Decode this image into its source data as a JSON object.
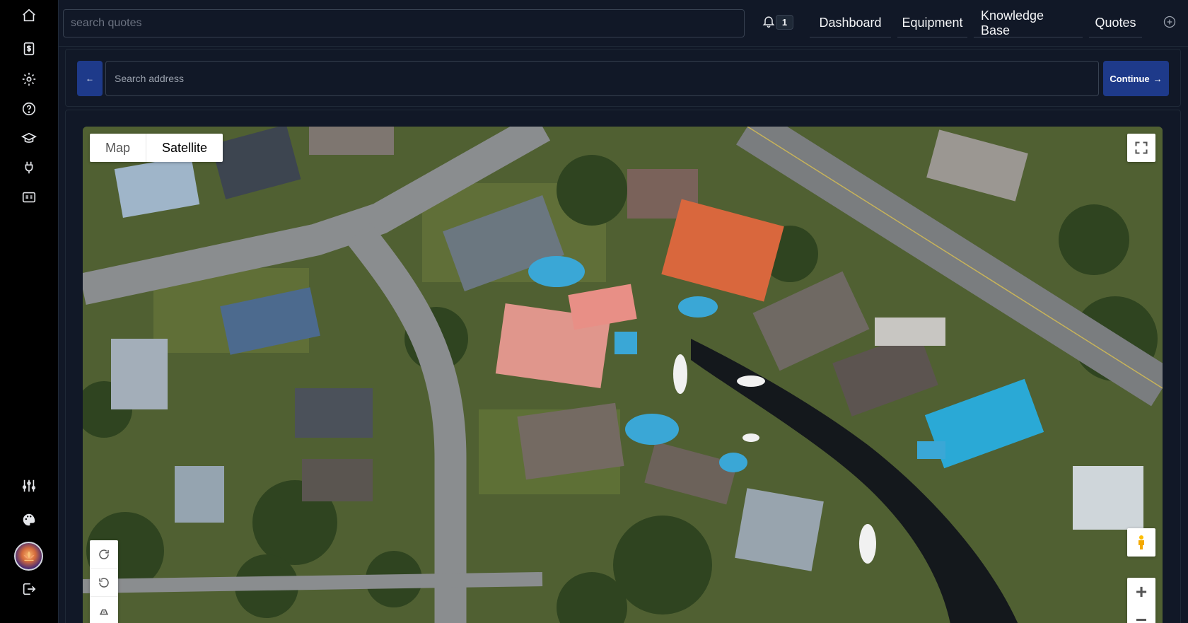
{
  "sidebar": {
    "icons": [
      "home-icon",
      "document-dollar-icon",
      "gear-icon",
      "help-circle-icon",
      "graduation-cap-icon",
      "plug-icon",
      "id-card-icon",
      "sliders-icon",
      "palette-icon",
      "logout-icon"
    ]
  },
  "header": {
    "search_placeholder": "search quotes",
    "notification_count": "1",
    "nav": {
      "dashboard": "Dashboard",
      "equipment": "Equipment",
      "knowledge_base": "Knowledge Base",
      "quotes": "Quotes"
    }
  },
  "address": {
    "back_label": "←",
    "search_placeholder": "Search address",
    "continue_label": "Continue",
    "continue_arrow": "→"
  },
  "map": {
    "type_map": "Map",
    "type_satellite": "Satellite",
    "selected_type": "Satellite",
    "zoom_in": "+",
    "zoom_out": "−"
  },
  "colors": {
    "background": "#111827",
    "sidebar": "#000000",
    "accent": "#1e3a8a"
  }
}
